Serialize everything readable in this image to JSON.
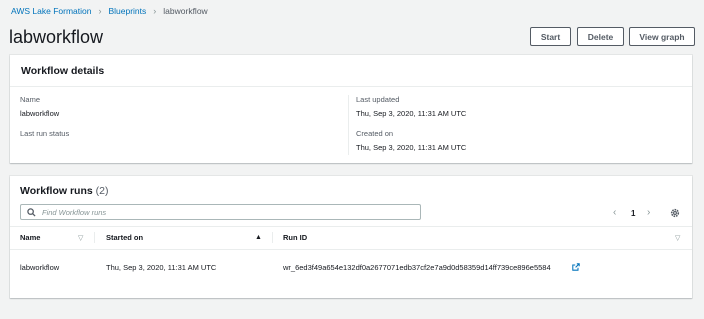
{
  "breadcrumb": {
    "items": [
      "AWS Lake Formation",
      "Blueprints"
    ],
    "current": "labworkflow"
  },
  "page": {
    "title": "labworkflow"
  },
  "actions": {
    "start": "Start",
    "delete": "Delete",
    "view_graph": "View graph"
  },
  "details": {
    "title": "Workflow details",
    "name_label": "Name",
    "name_value": "labworkflow",
    "last_run_status_label": "Last run status",
    "last_updated_label": "Last updated",
    "last_updated_value": "Thu, Sep 3, 2020, 11:31 AM UTC",
    "created_on_label": "Created on",
    "created_on_value": "Thu, Sep 3, 2020, 11:31 AM UTC"
  },
  "runs": {
    "title": "Workflow runs",
    "count": "(2)",
    "search_placeholder": "Find Workflow runs",
    "page_number": "1",
    "columns": {
      "name": "Name",
      "started_on": "Started on",
      "run_id": "Run ID"
    },
    "rows": [
      {
        "name": "labworkflow",
        "started_on": "Thu, Sep 3, 2020, 11:31 AM UTC",
        "run_id": "wr_6ed3f49a654e132df0a2677071edb37cf2e7a9d0d58359d14ff739ce896e5584"
      }
    ]
  },
  "colors": {
    "link": "#0073bb",
    "background": "#f2f3f3",
    "text": "#16191f",
    "muted": "#545b64"
  }
}
